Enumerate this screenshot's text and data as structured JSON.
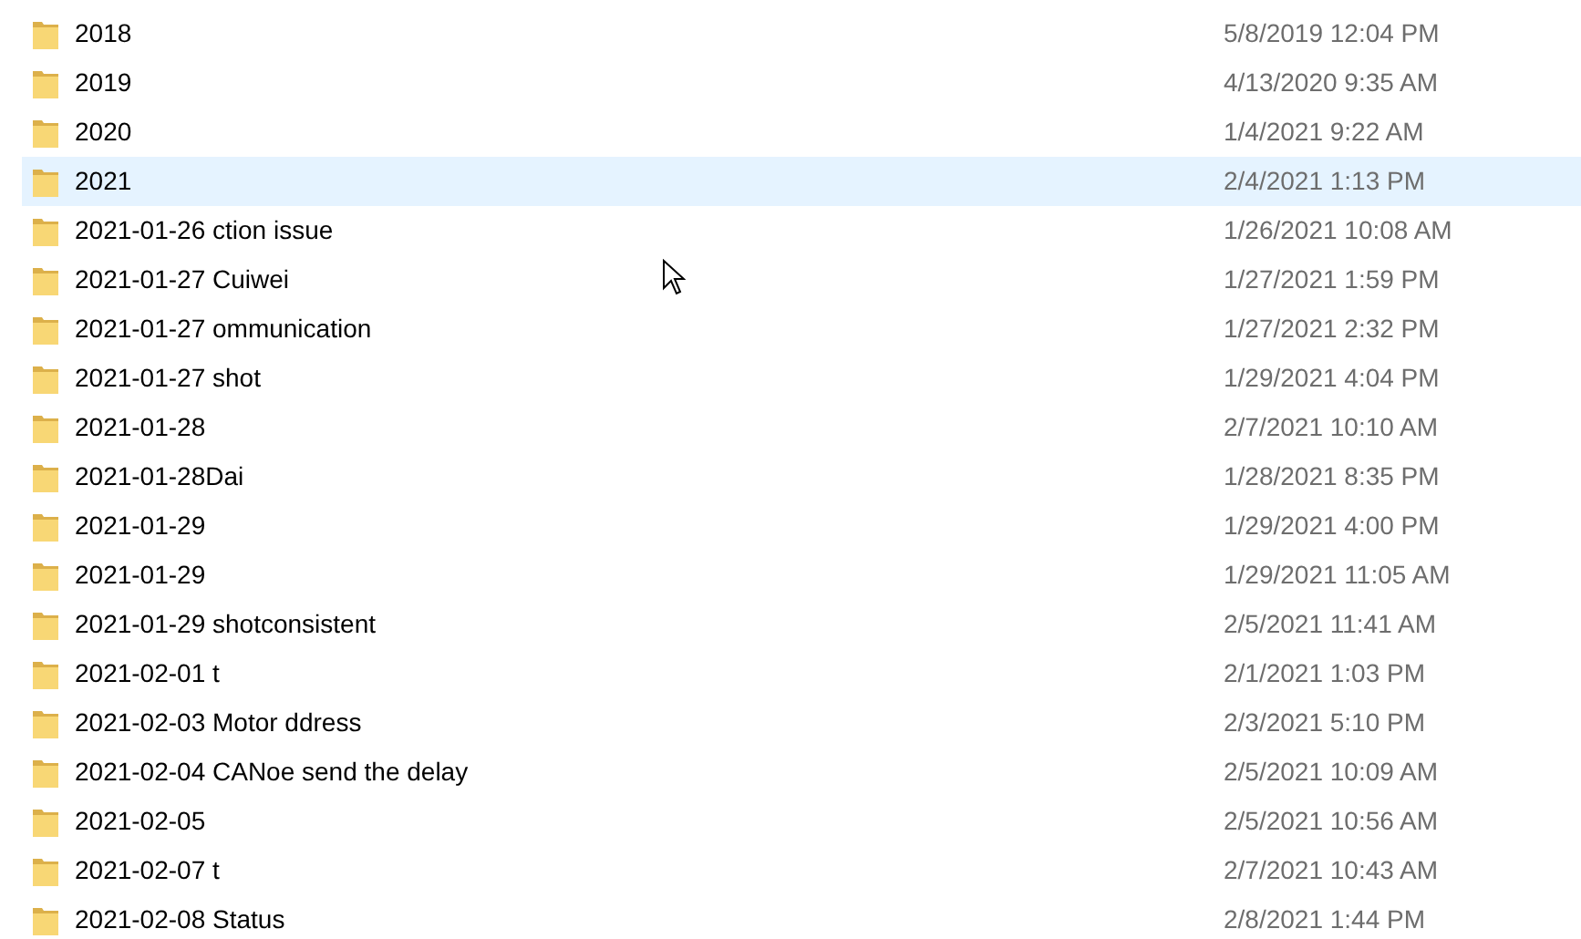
{
  "files": [
    {
      "name": "2018",
      "date_modified": "5/8/2019 12:04 PM",
      "selected": false
    },
    {
      "name": "2019",
      "date_modified": "4/13/2020 9:35 AM",
      "selected": false
    },
    {
      "name": "2020",
      "date_modified": "1/4/2021 9:22 AM",
      "selected": false
    },
    {
      "name": "2021",
      "date_modified": "2/4/2021 1:13 PM",
      "selected": true
    },
    {
      "name": "2021-01-26 ction issue",
      "date_modified": "1/26/2021 10:08 AM",
      "selected": false
    },
    {
      "name": "2021-01-27 Cuiwei",
      "date_modified": "1/27/2021 1:59 PM",
      "selected": false
    },
    {
      "name": "2021-01-27 ommunication",
      "date_modified": "1/27/2021 2:32 PM",
      "selected": false
    },
    {
      "name": "2021-01-27 shot",
      "date_modified": "1/29/2021 4:04 PM",
      "selected": false
    },
    {
      "name": "2021-01-28",
      "date_modified": "2/7/2021 10:10 AM",
      "selected": false
    },
    {
      "name": "2021-01-28Dai",
      "date_modified": "1/28/2021 8:35 PM",
      "selected": false
    },
    {
      "name": "2021-01-29",
      "date_modified": "1/29/2021 4:00 PM",
      "selected": false
    },
    {
      "name": "2021-01-29",
      "date_modified": "1/29/2021 11:05 AM",
      "selected": false
    },
    {
      "name": "2021-01-29 shotconsistent",
      "date_modified": "2/5/2021 11:41 AM",
      "selected": false
    },
    {
      "name": "2021-02-01 t",
      "date_modified": "2/1/2021 1:03 PM",
      "selected": false
    },
    {
      "name": "2021-02-03 Motor ddress",
      "date_modified": "2/3/2021 5:10 PM",
      "selected": false
    },
    {
      "name": "2021-02-04 CANoe send the delay",
      "date_modified": "2/5/2021 10:09 AM",
      "selected": false
    },
    {
      "name": "2021-02-05",
      "date_modified": "2/5/2021 10:56 AM",
      "selected": false
    },
    {
      "name": "2021-02-07 t",
      "date_modified": "2/7/2021 10:43 AM",
      "selected": false
    },
    {
      "name": "2021-02-08 Status",
      "date_modified": "2/8/2021 1:44 PM",
      "selected": false
    }
  ]
}
